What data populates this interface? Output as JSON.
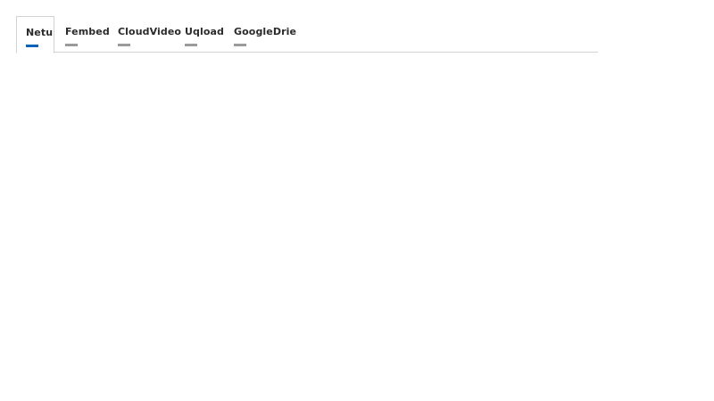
{
  "tabs": [
    {
      "label": "Netu",
      "active": true
    },
    {
      "label": "Fembed",
      "active": false
    },
    {
      "label": "CloudVideo",
      "active": false
    },
    {
      "label": "Uqload",
      "active": false
    },
    {
      "label": "GoogleDrie",
      "active": false
    }
  ],
  "colors": {
    "active_indicator": "#0a63b8",
    "inactive_indicator": "#9a9a9a",
    "border": "#d2d2d2"
  }
}
